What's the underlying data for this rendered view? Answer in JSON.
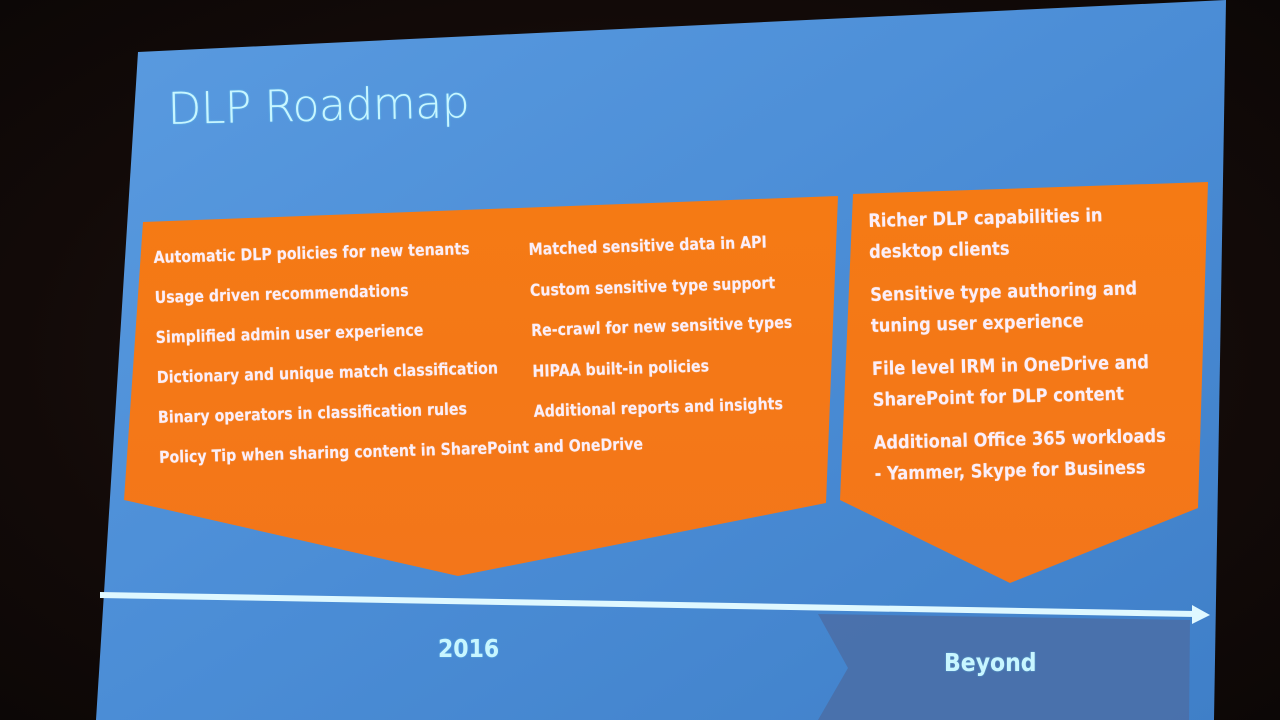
{
  "slide": {
    "title": "DLP Roadmap",
    "colors": {
      "background": "#4d8fd6",
      "accent_orange": "#f47a16",
      "timeline_line": "#dff8ff",
      "beyond_band": "#4a70a8",
      "title_text": "#c8f6ff",
      "body_text": "#fbeef8"
    },
    "phase_2016": {
      "label": "2016",
      "left_column": [
        "Automatic DLP policies for new tenants",
        "Usage driven recommendations",
        "Simplified admin user experience",
        "Dictionary and unique match classification",
        "Binary operators in classification rules",
        "Policy Tip when sharing content in SharePoint and OneDrive"
      ],
      "right_column": [
        "Matched sensitive data in API",
        "Custom sensitive type support",
        "Re-crawl for new sensitive types",
        "HIPAA built-in policies",
        "Additional reports and insights"
      ]
    },
    "phase_beyond": {
      "label": "Beyond",
      "items": [
        {
          "line1": "Richer DLP capabilities in",
          "line2": "desktop clients"
        },
        {
          "line1": "Sensitive type authoring and",
          "line2": "tuning user experience"
        },
        {
          "line1": "File level IRM in OneDrive and",
          "line2": "SharePoint for DLP content"
        },
        {
          "line1": "Additional Office 365 workloads",
          "line2": "- Yammer, Skype for Business"
        }
      ]
    }
  }
}
